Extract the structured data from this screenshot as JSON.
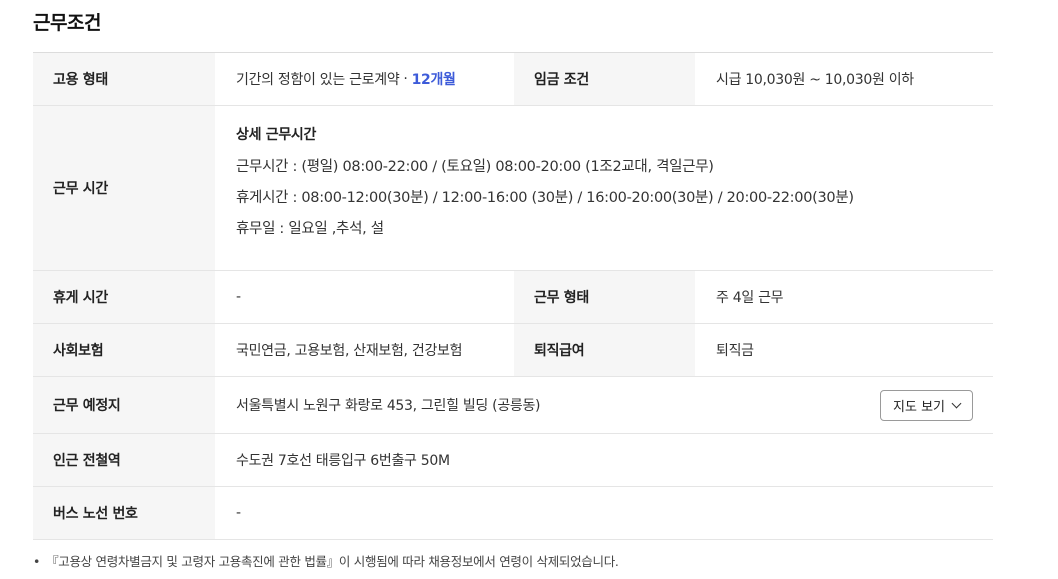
{
  "section": {
    "title": "근무조건"
  },
  "rows": {
    "employment": {
      "label": "고용 형태",
      "value": "기간의 정함이 있는 근로계약",
      "separator": "·",
      "duration": "12개월",
      "label2": "임금 조건",
      "value2": "시급 10,030원 ~ 10,030원 이하"
    },
    "work_hours": {
      "label": "근무 시간",
      "detail_title": "상세 근무시간",
      "lines": [
        "근무시간 : (평일) 08:00-22:00 / (토요일)  08:00-20:00  (1조2교대, 격일근무)",
        "휴게시간 : 08:00-12:00(30분) / 12:00-16:00 (30분) / 16:00-20:00(30분) / 20:00-22:00(30분)",
        "휴무일 : 일요일 ,추석, 설"
      ]
    },
    "break": {
      "label": "휴게 시간",
      "value": "-",
      "label2": "근무 형태",
      "value2": "주 4일 근무"
    },
    "insurance": {
      "label": "사회보험",
      "value": "국민연금, 고용보험, 산재보험, 건강보험",
      "label2": "퇴직급여",
      "value2": "퇴직금"
    },
    "location": {
      "label": "근무 예정지",
      "value": "서울특별시 노원구 화랑로 453, 그린힐 빌딩 (공릉동)",
      "map_button": "지도 보기"
    },
    "station": {
      "label": "인근 전철역",
      "value": "수도권 7호선 태릉입구 6번출구 50M"
    },
    "bus": {
      "label": "버스 노선 번호",
      "value": "-"
    }
  },
  "footnote": {
    "bullet": "•",
    "text": "『고용상 연령차별금지 및 고령자 고용촉진에 관한 법률』이 시행됨에 따라 채용정보에서 연령이 삭제되었습니다."
  },
  "colors": {
    "accent": "#3d5bd9",
    "header_bg": "#f6f6f6"
  }
}
